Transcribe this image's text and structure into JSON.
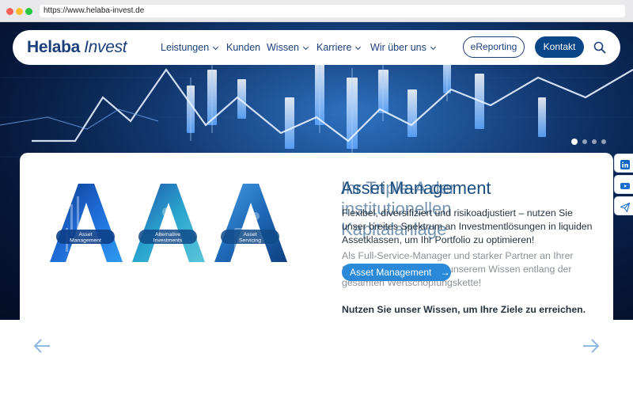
{
  "browser": {
    "url": "https://www.helaba-invest.de"
  },
  "nav": {
    "logo_bold": "Helaba",
    "logo_italic": "Invest",
    "items": [
      {
        "label": "Leistungen",
        "has_dropdown": true
      },
      {
        "label": "Kunden",
        "has_dropdown": false
      },
      {
        "label": "Wissen",
        "has_dropdown": true
      },
      {
        "label": "Karriere",
        "has_dropdown": true
      },
      {
        "label": "Wir über uns",
        "has_dropdown": true
      }
    ],
    "ereporting_label": "eReporting",
    "kontakt_label": "Kontakt",
    "search_icon": "search-icon"
  },
  "slider": {
    "dot_count": 4,
    "active_index": 0
  },
  "social": [
    "linkedin-icon",
    "youtube-icon",
    "newsletter-icon"
  ],
  "card": {
    "logo_letters": [
      {
        "caption_line1": "Asset",
        "caption_line2": "Management"
      },
      {
        "caption_line1": "Alternative",
        "caption_line2": "Investments"
      },
      {
        "caption_line1": "Asset",
        "caption_line2": "Servicing"
      }
    ],
    "title_front": "Asset Management",
    "title_back_line1": "Ihr Triple-A der",
    "title_back_line2": "institutionellen",
    "title_back_line3": "Kapitalanlage",
    "paragraph_front": "Flexibel, diversifiziert und risikoadjustiert – nutzen Sie unser breites Spektrum an Investmentlösungen in liquiden Assetklassen, um Ihr Portfolio zu optimieren!",
    "paragraph_back": "Als Full-Service-Manager und starker Partner an Ihrer Seite profitieren Sie von unserem Wissen entlang der gesamten Wertschöpfungskette!",
    "cta_label": "Asset Management",
    "tagline": "Nutzen Sie unser Wissen, um Ihre Ziele zu erreichen."
  },
  "colors": {
    "navy": "#1b3f7a",
    "button": "#0a4587",
    "cta": "#2a8ad9",
    "arrow": "#8fb8e3"
  }
}
